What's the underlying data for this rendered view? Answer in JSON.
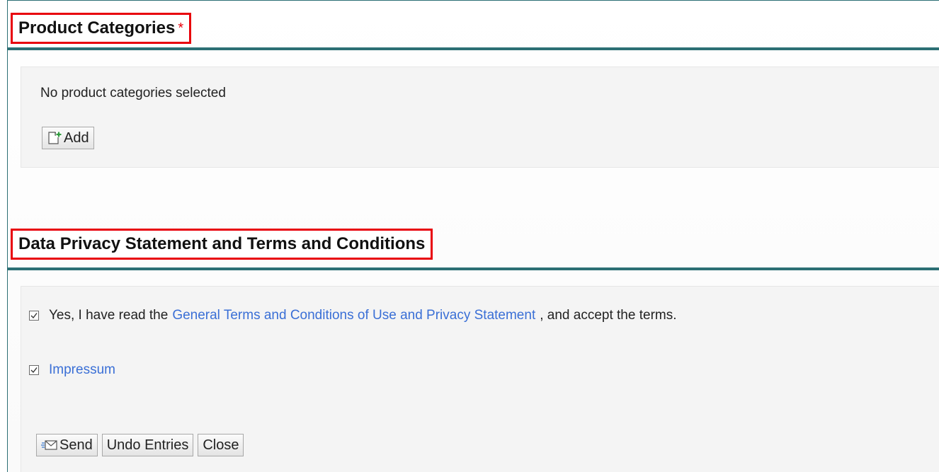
{
  "product_categories": {
    "title": "Product Categories",
    "required_mark": "*",
    "empty_text": "No product categories selected",
    "add_label": "Add"
  },
  "privacy": {
    "title": "Data Privacy Statement and Terms and Conditions",
    "terms_prefix": "Yes, I have read the",
    "terms_link": "General Terms and Conditions of Use and Privacy Statement",
    "terms_suffix": ", and accept the terms.",
    "terms_checked": true,
    "impressum_link": "Impressum",
    "impressum_checked": true
  },
  "actions": {
    "send_label": "Send",
    "undo_label": "Undo Entries",
    "close_label": "Close"
  },
  "colors": {
    "accent": "#2c6f74",
    "highlight": "#e8000b",
    "link": "#3a6fd6",
    "panel": "#f4f4f4"
  }
}
